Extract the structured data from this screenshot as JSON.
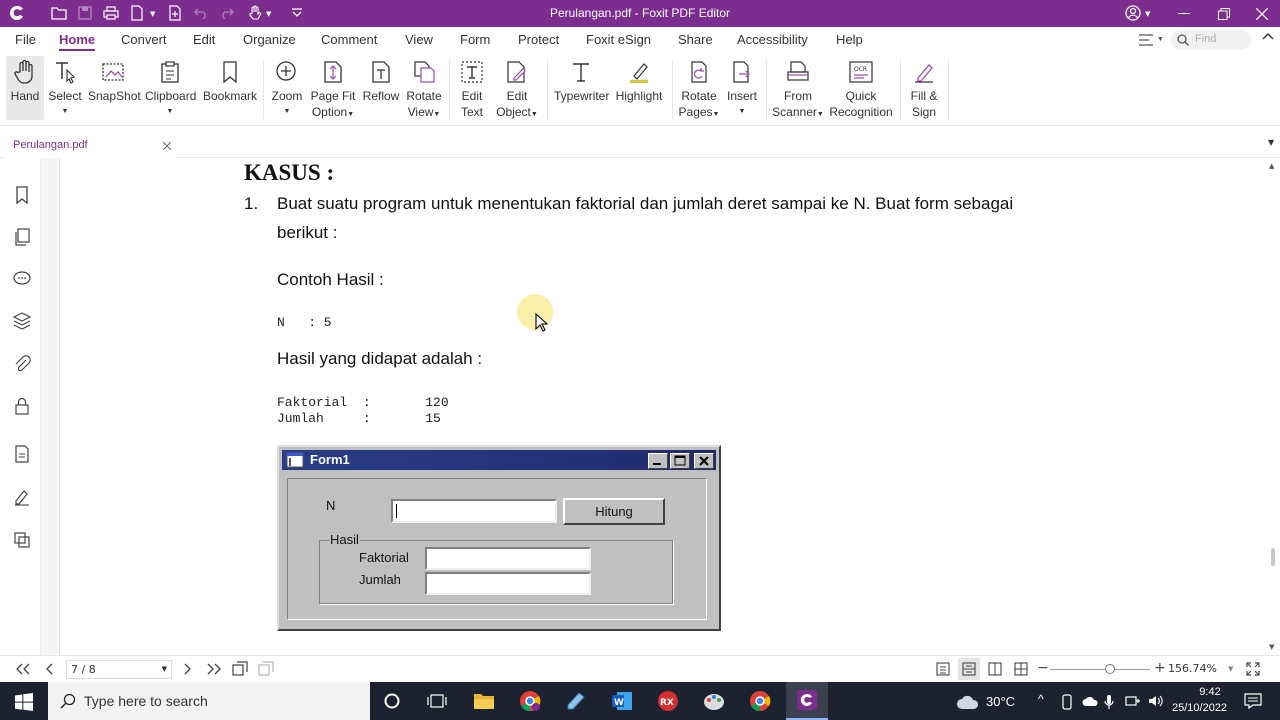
{
  "window": {
    "title": "Perulangan.pdf - Foxit PDF Editor",
    "theme_color": "#7c2d8e"
  },
  "menu": [
    "File",
    "Home",
    "Convert",
    "Edit",
    "Organize",
    "Comment",
    "View",
    "Form",
    "Protect",
    "Foxit eSign",
    "Share",
    "Accessibility",
    "Help"
  ],
  "find_placeholder": "Find",
  "ribbon": {
    "hand": "Hand",
    "select": "Select",
    "snapshot": "SnapShot",
    "clipboard": "Clipboard",
    "bookmark": "Bookmark",
    "zoom": "Zoom",
    "page_fit_1": "Page Fit",
    "page_fit_2": "Option",
    "reflow": "Reflow",
    "rotate_view_1": "Rotate",
    "rotate_view_2": "View",
    "edit_text_1": "Edit",
    "edit_text_2": "Text",
    "edit_object_1": "Edit",
    "edit_object_2": "Object",
    "typewriter": "Typewriter",
    "highlight": "Highlight",
    "rotate_pages_1": "Rotate",
    "rotate_pages_2": "Pages",
    "insert": "Insert",
    "from_scanner_1": "From",
    "from_scanner_2": "Scanner",
    "quick_rec_1": "Quick",
    "quick_rec_2": "Recognition",
    "fill_sign_1": "Fill &",
    "fill_sign_2": "Sign",
    "ocr_badge": "OCR"
  },
  "tab": {
    "name": "Perulangan.pdf"
  },
  "document": {
    "heading": "KASUS :",
    "item_number": "1.",
    "item_line1": "Buat suatu program untuk menentukan faktorial dan jumlah deret sampai ke N. Buat form sebagai",
    "item_line2": "berikut :",
    "contoh": "Contoh Hasil :",
    "n_line": "N   : 5",
    "hasil": "Hasil yang didapat adalah :",
    "faktorial_line": "Faktorial  :       120",
    "jumlah_line": "Jumlah     :       15"
  },
  "form": {
    "title": "Form1",
    "n_label": "N",
    "button": "Hitung",
    "group": "Hasil",
    "faktorial_label": "Faktorial",
    "jumlah_label": "Jumlah"
  },
  "status": {
    "page": "7 / 8",
    "zoom": "156.74%",
    "zoom_slider_fraction": 0.6
  },
  "taskbar": {
    "search_placeholder": "Type here to search",
    "weather": "30°C",
    "time": "9:42",
    "date": "25/10/2022"
  }
}
